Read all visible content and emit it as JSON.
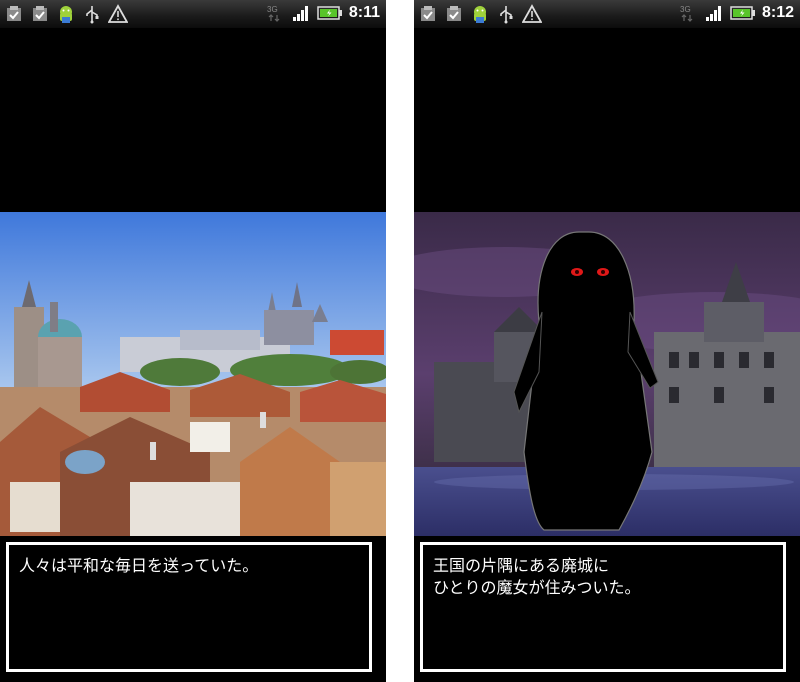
{
  "screens": [
    {
      "status_bar": {
        "time": "8:11",
        "notification_icons": [
          "task-check-icon",
          "task-check-icon",
          "android-icon",
          "usb-icon",
          "warning-icon"
        ],
        "system_icons": [
          "3g-icon",
          "signal-icon",
          "battery-icon"
        ]
      },
      "scene": "prague-city",
      "message": {
        "lines": [
          "人々は平和な毎日を送っていた。"
        ]
      }
    },
    {
      "status_bar": {
        "time": "8:12",
        "notification_icons": [
          "task-check-icon",
          "task-check-icon",
          "android-icon",
          "usb-icon",
          "warning-icon"
        ],
        "system_icons": [
          "3g-icon",
          "signal-icon",
          "battery-icon"
        ]
      },
      "scene": "ruined-castle-witch",
      "message": {
        "lines": [
          "王国の片隅にある廃城に",
          "ひとりの魔女が住みついた。"
        ]
      }
    }
  ],
  "colors": {
    "battery_green": "#58c42a",
    "witch_eye": "#e01818",
    "night_sky": "#2e1f3a",
    "day_sky": "#4d86e0"
  }
}
